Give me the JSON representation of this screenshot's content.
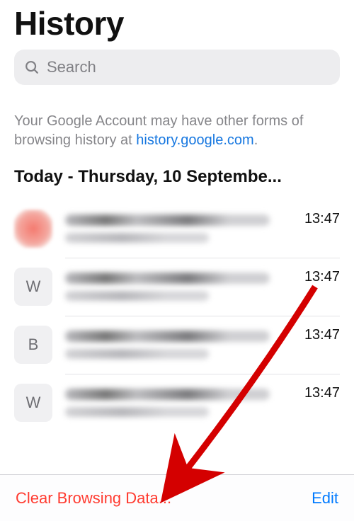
{
  "header": {
    "title": "History"
  },
  "search": {
    "placeholder": "Search"
  },
  "notice": {
    "prefix": "Your Google Account may have other forms of browsing history at ",
    "link_text": "history.google.com",
    "suffix": "."
  },
  "section": {
    "heading": "Today - Thursday, 10 Septembe..."
  },
  "rows": [
    {
      "favicon_kind": "red",
      "favicon_letter": "",
      "time": "13:47"
    },
    {
      "favicon_kind": "letter",
      "favicon_letter": "W",
      "time": "13:47"
    },
    {
      "favicon_kind": "letter",
      "favicon_letter": "B",
      "time": "13:47"
    },
    {
      "favicon_kind": "letter",
      "favicon_letter": "W",
      "time": "13:47"
    }
  ],
  "toolbar": {
    "clear_label": "Clear Browsing Data...",
    "edit_label": "Edit"
  },
  "colors": {
    "destructive": "#ff3b30",
    "link": "#007aff"
  }
}
